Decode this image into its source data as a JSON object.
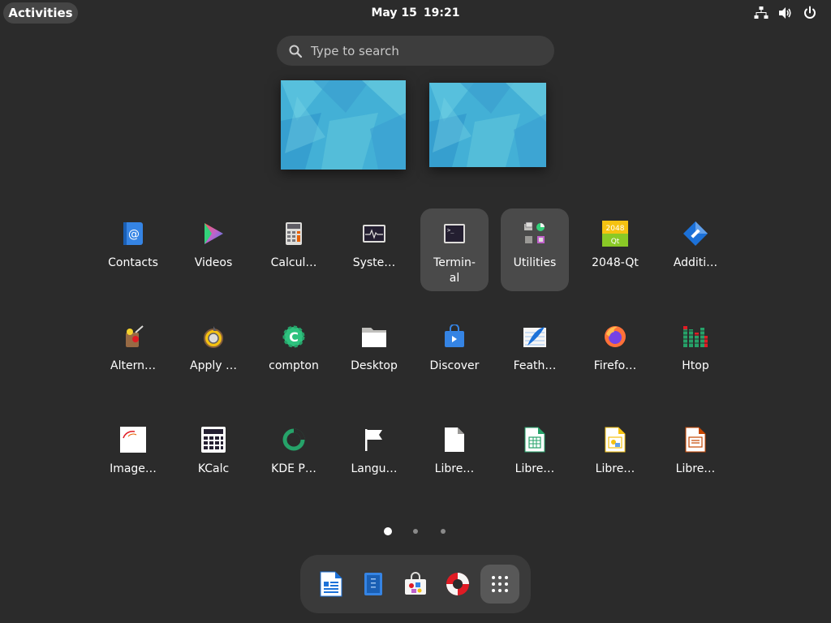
{
  "topbar": {
    "activities_label": "Activities",
    "date": "May 15",
    "time": "19:21",
    "tray_icons": [
      "network-icon",
      "volume-icon",
      "power-icon"
    ]
  },
  "search": {
    "placeholder": "Type to search"
  },
  "workspaces": [
    {
      "name": "workspace-1",
      "background": "#3ea8d4"
    },
    {
      "name": "workspace-2",
      "background": "#3ea8d4"
    }
  ],
  "apps": [
    {
      "label": "Contacts",
      "icon": "contacts-icon"
    },
    {
      "label": "Videos",
      "icon": "videos-icon"
    },
    {
      "label": "Calcul…",
      "icon": "calculator-icon"
    },
    {
      "label": "Syste…",
      "icon": "system-monitor-icon"
    },
    {
      "label": "Termin-\nal",
      "icon": "terminal-icon",
      "selected": true
    },
    {
      "label": "Utilities",
      "icon": "utilities-folder-icon",
      "selected": true
    },
    {
      "label": "2048-Qt",
      "icon": "2048-qt-icon"
    },
    {
      "label": "Additi…",
      "icon": "additional-drivers-icon"
    },
    {
      "label": "Altern…",
      "icon": "alternatives-configurator-icon"
    },
    {
      "label": "Apply …",
      "icon": "apply-patch-icon"
    },
    {
      "label": "compton",
      "icon": "compton-icon"
    },
    {
      "label": "Desktop",
      "icon": "desktop-folder-icon"
    },
    {
      "label": "Discover",
      "icon": "discover-icon"
    },
    {
      "label": "Feath…",
      "icon": "feathernotes-icon"
    },
    {
      "label": "Firefo…",
      "icon": "firefox-icon"
    },
    {
      "label": "Htop",
      "icon": "htop-icon"
    },
    {
      "label": "Image…",
      "icon": "image-viewer-icon"
    },
    {
      "label": "KCalc",
      "icon": "kcalc-icon"
    },
    {
      "label": "KDE P…",
      "icon": "kde-partition-manager-icon"
    },
    {
      "label": "Langu…",
      "icon": "language-support-icon"
    },
    {
      "label": "Libre…",
      "icon": "libreoffice-icon"
    },
    {
      "label": "Libre…",
      "icon": "libreoffice-calc-icon"
    },
    {
      "label": "Libre…",
      "icon": "libreoffice-draw-icon"
    },
    {
      "label": "Libre…",
      "icon": "libreoffice-impress-icon"
    }
  ],
  "pagination": {
    "pages": 3,
    "current": 1
  },
  "dock": [
    {
      "icon": "libreoffice-writer-icon"
    },
    {
      "icon": "text-editor-icon"
    },
    {
      "icon": "software-center-icon"
    },
    {
      "icon": "help-icon"
    },
    {
      "icon": "show-apps-icon"
    }
  ],
  "colors": {
    "background": "#2b2b2b",
    "panel": "#3a3a3a",
    "selection": "#4a4a4a",
    "accent": "#3584e4"
  }
}
